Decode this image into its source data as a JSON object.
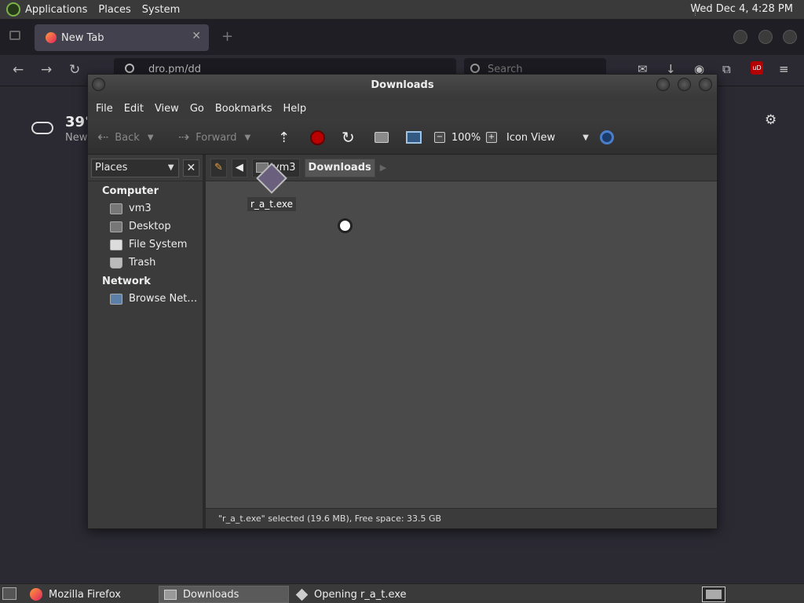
{
  "top_panel": {
    "menus": [
      "Applications",
      "Places",
      "System"
    ],
    "clock": "Wed Dec  4,  4:28 PM"
  },
  "firefox": {
    "tab_title": "New Tab",
    "url": "dro.pm/dd",
    "search_placeholder": "Search",
    "ublock_label": "uD",
    "weather": {
      "temp": "39°",
      "location": "New"
    }
  },
  "window": {
    "title": "Downloads",
    "menubar": [
      "File",
      "Edit",
      "View",
      "Go",
      "Bookmarks",
      "Help"
    ],
    "toolbar": {
      "back": "Back",
      "forward": "Forward",
      "zoom": "100%",
      "view_mode": "Icon View"
    },
    "sidebar": {
      "selector": "Places",
      "sections": [
        {
          "title": "Computer",
          "items": [
            "vm3",
            "Desktop",
            "File System",
            "Trash"
          ]
        },
        {
          "title": "Network",
          "items": [
            "Browse Net…"
          ]
        }
      ]
    },
    "pathbar": {
      "segments": [
        "vm3",
        "Downloads"
      ]
    },
    "files": [
      {
        "name": "r_a_t.exe"
      }
    ],
    "status": "\"r_a_t.exe\" selected (19.6 MB), Free space: 33.5 GB"
  },
  "taskbar": {
    "tasks": [
      "Mozilla Firefox",
      "Downloads",
      "Opening r_a_t.exe"
    ]
  }
}
